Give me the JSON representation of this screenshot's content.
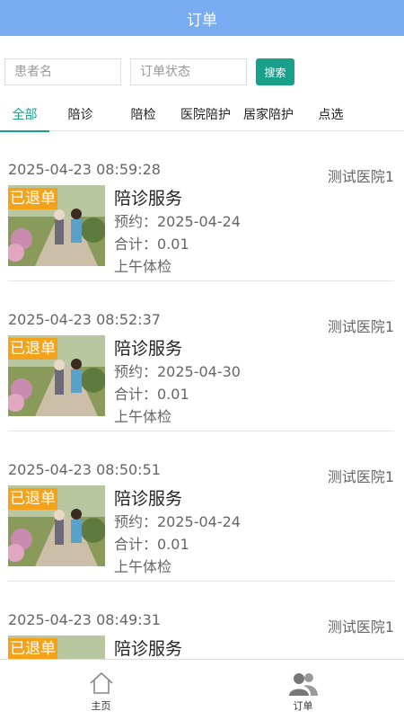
{
  "header": {
    "title": "订单"
  },
  "search": {
    "patient_placeholder": "患者名",
    "status_placeholder": "订单状态",
    "button_label": "搜索"
  },
  "tabs": [
    "全部",
    "陪诊",
    "陪检",
    "医院陪护",
    "居家陪护",
    "点选"
  ],
  "active_tab": 0,
  "orders": [
    {
      "time": "2025-04-23 08:59:28",
      "hospital": "测试医院1",
      "badge": "已退单",
      "service": "陪诊服务",
      "appointment": "预约：2025-04-24",
      "total": "合计：0.01",
      "note": "上午体检"
    },
    {
      "time": "2025-04-23 08:52:37",
      "hospital": "测试医院1",
      "badge": "已退单",
      "service": "陪诊服务",
      "appointment": "预约：2025-04-30",
      "total": "合计：0.01",
      "note": "上午体检"
    },
    {
      "time": "2025-04-23 08:50:51",
      "hospital": "测试医院1",
      "badge": "已退单",
      "service": "陪诊服务",
      "appointment": "预约：2025-04-24",
      "total": "合计：0.01",
      "note": "上午体检"
    },
    {
      "time": "2025-04-23 08:49:31",
      "hospital": "测试医院1",
      "badge": "已退单",
      "service": "陪诊服务",
      "appointment": "",
      "total": "",
      "note": ""
    }
  ],
  "bottom_nav": [
    {
      "label": "主页",
      "icon": "home-icon"
    },
    {
      "label": "订单",
      "icon": "users-icon"
    }
  ],
  "colors": {
    "header": "#79acf0",
    "accent": "#18a08a",
    "badge": "#f5a21b"
  }
}
